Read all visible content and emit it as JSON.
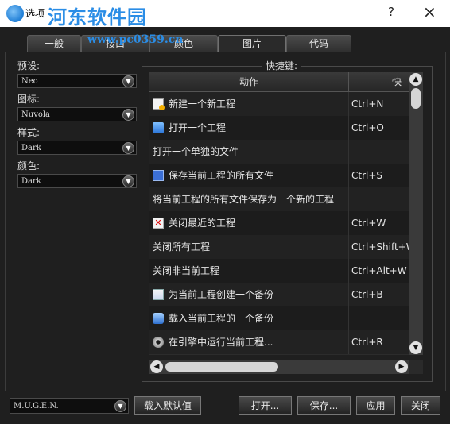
{
  "window": {
    "title": "选项",
    "help": "?",
    "close": "×"
  },
  "watermark": {
    "text": "河东软件园",
    "url": "www.pc0359.cn"
  },
  "tabs": [
    {
      "label": "一般"
    },
    {
      "label": "接口"
    },
    {
      "label": "颜色"
    },
    {
      "label": "图片"
    },
    {
      "label": "代码"
    }
  ],
  "left": {
    "preset_label": "预设:",
    "preset_value": "Neo",
    "icon_label": "图标:",
    "icon_value": "Nuvola",
    "style_label": "样式:",
    "style_value": "Dark",
    "color_label": "颜色:",
    "color_value": "Dark"
  },
  "shortcuts": {
    "group_title": "快捷键:",
    "col_action": "动作",
    "col_shortcut": "快捷",
    "rows": [
      {
        "icon": "new-project-icon",
        "action": "新建一个新工程",
        "key": "Ctrl+N"
      },
      {
        "icon": "open-project-icon",
        "action": "打开一个工程",
        "key": "Ctrl+O"
      },
      {
        "icon": "",
        "action": "打开一个单独的文件",
        "key": ""
      },
      {
        "icon": "save-icon",
        "action": "保存当前工程的所有文件",
        "key": "Ctrl+S"
      },
      {
        "icon": "",
        "action": "将当前工程的所有文件保存为一个新的工程",
        "key": ""
      },
      {
        "icon": "close-project-icon",
        "action": "关闭最近的工程",
        "key": "Ctrl+W"
      },
      {
        "icon": "",
        "action": "关闭所有工程",
        "key": "Ctrl+Shift+W"
      },
      {
        "icon": "",
        "action": "关闭非当前工程",
        "key": "Ctrl+Alt+W"
      },
      {
        "icon": "backup-icon",
        "action": "为当前工程创建一个备份",
        "key": "Ctrl+B"
      },
      {
        "icon": "load-backup-icon",
        "action": "载入当前工程的一个备份",
        "key": ""
      },
      {
        "icon": "gear-icon",
        "action": "在引擎中运行当前工程...",
        "key": "Ctrl+R"
      }
    ]
  },
  "bottom": {
    "engine_value": "M.U.G.E.N.",
    "load_default": "载入默认值",
    "open": "打开...",
    "save": "保存...",
    "apply": "应用",
    "close": "关闭"
  },
  "colors": {
    "background": "#1f1f1f",
    "titlebar": "#ffffff",
    "watermark": "#2a8de6"
  }
}
